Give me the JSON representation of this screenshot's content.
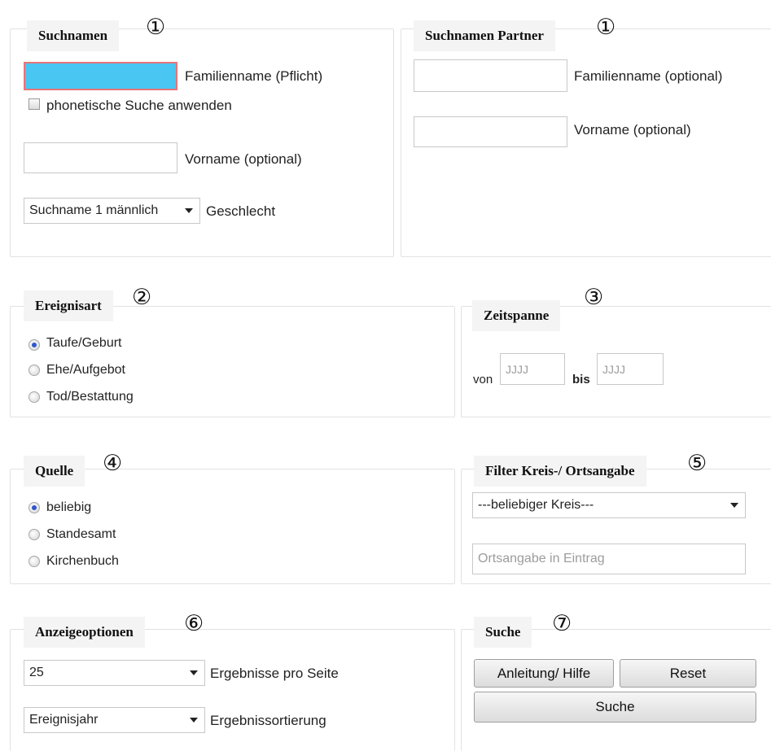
{
  "badges": {
    "b1": "①",
    "b2": "②",
    "b3": "③",
    "b4": "④",
    "b5": "⑤",
    "b6": "⑥",
    "b7": "⑦"
  },
  "suchnamen": {
    "title": "Suchnamen",
    "family_value": "",
    "family_label": "Familienname (Pflicht)",
    "phonetic_label": "phonetische Suche anwenden",
    "first_value": "",
    "first_label": "Vorname (optional)",
    "gender_selected": "Suchname 1 männlich",
    "gender_label": "Geschlecht"
  },
  "partner": {
    "title": "Suchnamen Partner",
    "family_value": "",
    "family_label": "Familienname (optional)",
    "first_value": "",
    "first_label": "Vorname (optional)"
  },
  "ereignisart": {
    "title": "Ereignisart",
    "options": [
      "Taufe/Geburt",
      "Ehe/Aufgebot",
      "Tod/Bestattung"
    ],
    "selected": "Taufe/Geburt"
  },
  "zeitspanne": {
    "title": "Zeitspanne",
    "von_label": "von",
    "von_placeholder": "JJJJ",
    "bis_label": "bis",
    "bis_placeholder": "JJJJ"
  },
  "quelle": {
    "title": "Quelle",
    "options": [
      "beliebig",
      "Standesamt",
      "Kirchenbuch"
    ],
    "selected": "beliebig"
  },
  "filter": {
    "title": "Filter Kreis-/ Ortsangabe",
    "kreis_selected": "---beliebiger Kreis---",
    "ort_placeholder": "Ortsangabe in Eintrag"
  },
  "anzeige": {
    "title": "Anzeigeoptionen",
    "per_page_selected": "25",
    "per_page_label": "Ergebnisse pro Seite",
    "sort_selected": "Ereignisjahr",
    "sort_label": "Ergebnissortierung"
  },
  "suche": {
    "title": "Suche",
    "help_label": "Anleitung/ Hilfe",
    "reset_label": "Reset",
    "search_label": "Suche"
  },
  "colors": {
    "required_fill": "#49c6f2",
    "required_border": "#e6767a",
    "radio_checked": "#2e58c9",
    "legend_bg": "#f4f4f4"
  }
}
